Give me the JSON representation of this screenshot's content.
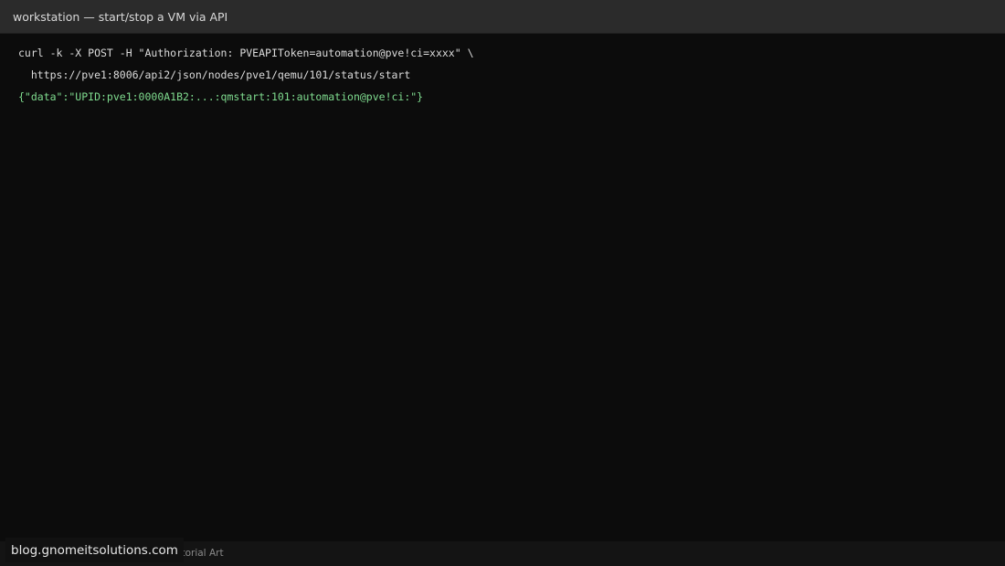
{
  "window": {
    "title": "workstation — start/stop a VM via API"
  },
  "terminal": {
    "lines": [
      {
        "text": "curl -k -X POST -H \"Authorization: PVEAPIToken=automation@pve!ci=xxxx\" \\",
        "kind": "command"
      },
      {
        "text": "  https://pve1:8006/api2/json/nodes/pve1/qemu/101/status/start",
        "kind": "command"
      },
      {
        "text": "{\"data\":\"UPID:pve1:0000A1B2:...:qmstart:101:automation@pve!ci:\"}",
        "kind": "output"
      }
    ]
  },
  "footer": {
    "caption": "Tutorial Art"
  },
  "watermark": {
    "text": "blog.gnomeitsolutions.com"
  },
  "colors": {
    "command_text": "#dcdcdc",
    "output_text": "#7fdc8f",
    "terminal_bg": "#0c0c0c",
    "titlebar_bg": "#2b2b2b"
  }
}
